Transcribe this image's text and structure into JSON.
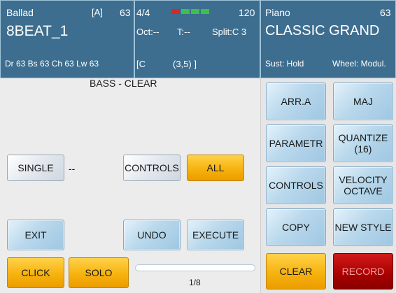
{
  "style_panel": {
    "style_name": "Ballad",
    "variation": "[A]",
    "style_number": "63",
    "style_title": "8BEAT_1",
    "channel_info": "Dr 63  Bs 63  Ch 63  Lw 63"
  },
  "status_panel": {
    "time_signature": "4/4",
    "tempo": "120",
    "octave": "Oct:--",
    "transpose": "T:--",
    "split": "Split:C 3",
    "chord_left": "[C",
    "chord_right": "(3,5) ]",
    "beat_lamps": [
      {
        "color": "#d9262b"
      },
      {
        "color": "#3fbf4c"
      },
      {
        "color": "#3fbf4c"
      },
      {
        "color": "#3fbf4c"
      }
    ]
  },
  "voice_panel": {
    "voice_category": "Piano",
    "voice_number": "63",
    "voice_title": "CLASSIC GRAND",
    "sustain": "Sust: Hold",
    "wheel": "Wheel: Modul."
  },
  "editor": {
    "title": "BASS - CLEAR",
    "single_label": "SINGLE",
    "single_value": "--",
    "controls_label": "CONTROLS",
    "all_label": "ALL",
    "exit_label": "EXIT",
    "undo_label": "UNDO",
    "execute_label": "EXECUTE",
    "click_label": "CLICK",
    "solo_label": "SOLO",
    "progress_value": 0.0,
    "page_indicator": "1/8"
  },
  "side_buttons": {
    "arr_label": "ARR.A",
    "maj_label": "MAJ",
    "parametr_label": "PARAMETR",
    "quantize_label": "QUANTIZE",
    "quantize_value": "(16)",
    "controls_label": "CONTROLS",
    "velocity_label": "VELOCITY",
    "octave_label": "OCTAVE",
    "copy_label": "COPY",
    "new_style_label": "NEW STYLE",
    "clear_label": "CLEAR",
    "record_label": "RECORD"
  },
  "colors": {
    "header_blue": "#3d6e8f",
    "button_orange": "#f6b30e",
    "record_red": "#a80000"
  }
}
